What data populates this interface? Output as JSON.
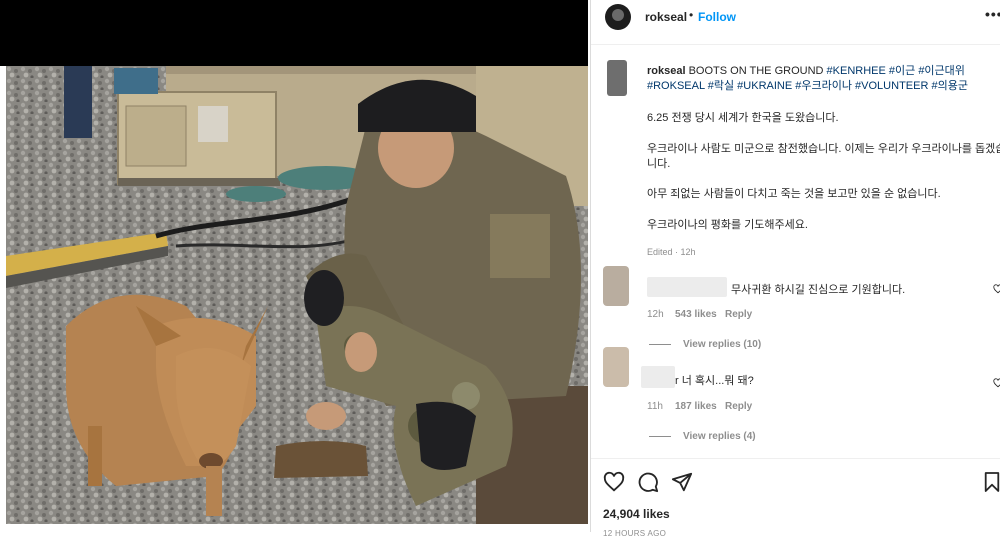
{
  "post": {
    "username": "rokseal",
    "follow_label": "Follow",
    "separator": "•",
    "more_label": "•••",
    "caption_user": "rokseal",
    "caption_text": "BOOTS ON THE GROUND",
    "hashtags": [
      "#KENRHEE",
      "#이근",
      "#이근대위",
      "#ROKSEAL",
      "#락실",
      "#UKRAINE",
      "#우크라이나",
      "#VOLUNTEER",
      "#의용군"
    ],
    "paragraphs": [
      "6.25 전쟁 당시 세계가 한국을 도왔습니다.",
      "우크라이나 사람도 미군으로 참전했습니다. 이제는 우리가 우크라이나를 돕겠습니다.",
      "아무 죄없는 사람들이 다치고 죽는 것을 보고만 있을 순 없습니다.",
      "우크라이나의 평화를 기도해주세요."
    ],
    "edited": "Edited · 12h",
    "likes": "24,904 likes",
    "time_ago": "12 HOURS AGO"
  },
  "comments": [
    {
      "text": "무사귀환 하시길 진심으로 기원합니다.",
      "time": "12h",
      "likes": "543 likes",
      "reply_label": "Reply",
      "view_replies": "View replies (10)"
    },
    {
      "text": "r 너 혹시...뭐 돼?",
      "time": "11h",
      "likes": "187 likes",
      "reply_label": "Reply",
      "view_replies": "View replies (4)"
    }
  ],
  "colors": {
    "accent": "#0095f6",
    "hashtag": "#00376b",
    "muted": "#8e8e8e",
    "text": "#262626"
  },
  "icons": [
    "heart-icon",
    "comment-icon",
    "share-icon",
    "bookmark-icon",
    "more-icon"
  ]
}
